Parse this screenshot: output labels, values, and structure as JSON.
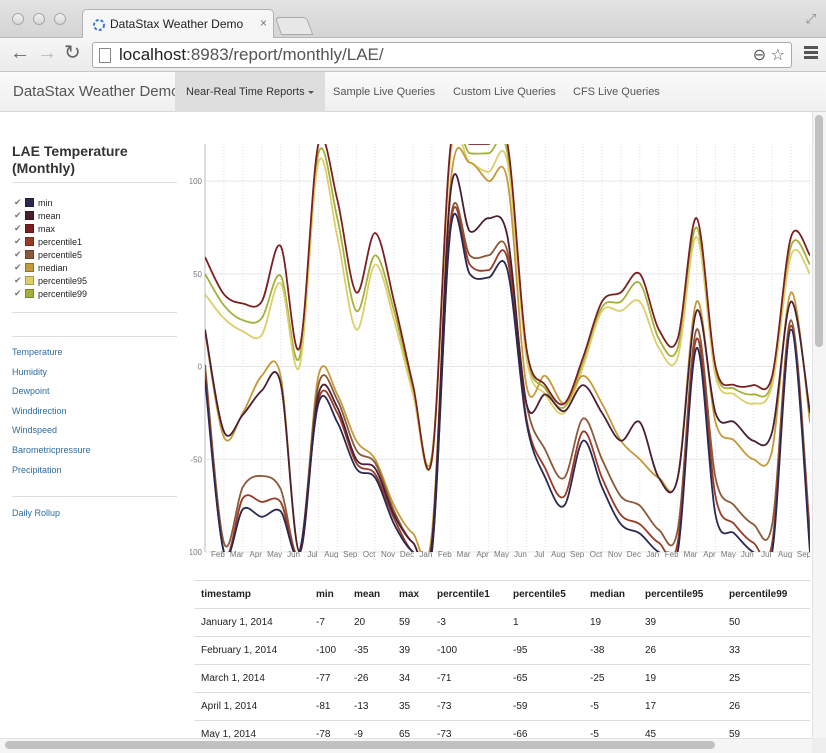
{
  "browser": {
    "tab_title": "DataStax Weather Demo",
    "tab_close": "×",
    "url_host": "localhost",
    "url_path": ":8983/report/monthly/LAE/",
    "back_icon": "←",
    "forward_icon": "→",
    "reload_icon": "↻",
    "zoom_icon": "⊖",
    "star_icon": "☆",
    "resize_icon": "⤢"
  },
  "navbar": {
    "brand": "DataStax Weather Demo",
    "items": [
      {
        "label": "Near-Real Time Reports"
      },
      {
        "label": "Sample Live Queries"
      },
      {
        "label": "Custom Live Queries"
      },
      {
        "label": "CFS Live Queries"
      }
    ]
  },
  "sidebar": {
    "title": "LAE Temperature (Monthly)",
    "check_glyph": "✔",
    "legend": [
      {
        "label": "min",
        "color": "#2b2950"
      },
      {
        "label": "mean",
        "color": "#4a1f32"
      },
      {
        "label": "max",
        "color": "#7b2020"
      },
      {
        "label": "percentile1",
        "color": "#9a3a27"
      },
      {
        "label": "percentile5",
        "color": "#8a5a3a"
      },
      {
        "label": "median",
        "color": "#c49a3a"
      },
      {
        "label": "percentile95",
        "color": "#dccf6a"
      },
      {
        "label": "percentile99",
        "color": "#a4b03c"
      }
    ],
    "links": [
      {
        "label": "Temperature"
      },
      {
        "label": "Humidity"
      },
      {
        "label": "Dewpoint"
      },
      {
        "label": "Winddirection"
      },
      {
        "label": "Windspeed"
      },
      {
        "label": "Barometricpressure"
      },
      {
        "label": "Precipitation"
      }
    ],
    "daily_rollup": "Daily Rollup"
  },
  "chart_data": {
    "type": "line",
    "ylim": [
      -100,
      120
    ],
    "yticks": [
      "100",
      "50",
      "0",
      "-50",
      "-100"
    ],
    "ytick_values": [
      100,
      50,
      0,
      -50,
      -100
    ],
    "x": [
      "Jan",
      "Feb",
      "Mar",
      "Apr",
      "May",
      "Jun",
      "Jul",
      "Aug",
      "Sep",
      "Oct",
      "Nov",
      "Dec",
      "Jan",
      "Feb",
      "Mar",
      "Apr",
      "May",
      "Jun",
      "Jul",
      "Aug",
      "Sep",
      "Oct",
      "Nov",
      "Dec",
      "Jan",
      "Feb",
      "Mar",
      "Apr",
      "May",
      "Jun",
      "Jul",
      "Aug",
      "Sep"
    ],
    "xtick_labels": [
      "Feb",
      "Mar",
      "Apr",
      "May",
      "Jun",
      "Jul",
      "Aug",
      "Sep",
      "Oct",
      "Nov",
      "Dec",
      "Jan",
      "Feb",
      "Mar",
      "Apr",
      "May",
      "Jun",
      "Jul",
      "Aug",
      "Sep",
      "Oct",
      "Nov",
      "Dec",
      "Jan",
      "Feb",
      "Mar",
      "Apr",
      "May",
      "Jun",
      "Jul",
      "Aug",
      "Sep"
    ],
    "series": [
      {
        "name": "min",
        "color": "#2b2950",
        "values": [
          -7,
          -100,
          -77,
          -81,
          -78,
          -100,
          -20,
          -30,
          -55,
          -60,
          -85,
          -100,
          -100,
          75,
          50,
          48,
          52,
          -30,
          -60,
          -75,
          -40,
          -65,
          -85,
          -90,
          -100,
          -100,
          10,
          -80,
          -90,
          -100,
          -100,
          20,
          -100
        ]
      },
      {
        "name": "mean",
        "color": "#4a1f32",
        "values": [
          20,
          -35,
          -26,
          -13,
          -9,
          -100,
          -15,
          -22,
          -50,
          -55,
          -80,
          -95,
          -95,
          95,
          73,
          80,
          70,
          -20,
          -15,
          -24,
          -10,
          -25,
          -40,
          -30,
          -60,
          -60,
          30,
          -25,
          -30,
          -40,
          -35,
          35,
          -25
        ]
      },
      {
        "name": "max",
        "color": "#7b2020",
        "values": [
          59,
          39,
          34,
          35,
          65,
          10,
          120,
          90,
          40,
          72,
          35,
          -10,
          -50,
          120,
          120,
          120,
          120,
          10,
          -10,
          -20,
          5,
          35,
          40,
          50,
          20,
          15,
          80,
          0,
          -10,
          -10,
          -5,
          70,
          60
        ]
      },
      {
        "name": "percentile1",
        "color": "#9a3a27",
        "values": [
          -3,
          -100,
          -71,
          -73,
          -73,
          -100,
          -18,
          -25,
          -52,
          -58,
          -82,
          -100,
          -100,
          78,
          55,
          52,
          58,
          -28,
          -55,
          -70,
          -35,
          -60,
          -80,
          -85,
          -95,
          -95,
          15,
          -70,
          -85,
          -95,
          -95,
          22,
          -95
        ]
      },
      {
        "name": "percentile5",
        "color": "#8a5a3a",
        "values": [
          1,
          -95,
          -65,
          -59,
          -66,
          -100,
          -10,
          -18,
          -45,
          -52,
          -78,
          -95,
          -95,
          80,
          60,
          60,
          62,
          -20,
          -45,
          -60,
          -28,
          -50,
          -70,
          -75,
          -88,
          -88,
          20,
          -60,
          -75,
          -85,
          -85,
          25,
          -90
        ]
      },
      {
        "name": "median",
        "color": "#c49a3a",
        "values": [
          19,
          -38,
          -25,
          -5,
          -5,
          -100,
          -5,
          -15,
          -40,
          -50,
          -75,
          -90,
          -90,
          100,
          110,
          100,
          100,
          -10,
          -5,
          -20,
          -5,
          -20,
          -40,
          -50,
          -60,
          -60,
          35,
          -30,
          -40,
          -50,
          -45,
          40,
          -30
        ]
      },
      {
        "name": "percentile95",
        "color": "#dccf6a",
        "values": [
          39,
          26,
          19,
          17,
          45,
          0,
          110,
          70,
          20,
          55,
          25,
          -15,
          -50,
          115,
          110,
          105,
          110,
          5,
          -15,
          -25,
          0,
          30,
          30,
          35,
          10,
          5,
          70,
          -5,
          -15,
          -20,
          -10,
          60,
          50
        ]
      },
      {
        "name": "percentile99",
        "color": "#a4b03c",
        "values": [
          50,
          33,
          25,
          26,
          49,
          5,
          115,
          80,
          30,
          60,
          30,
          -12,
          -48,
          118,
          115,
          115,
          115,
          8,
          -12,
          -22,
          2,
          32,
          35,
          45,
          15,
          10,
          75,
          -2,
          -12,
          -15,
          -8,
          65,
          55
        ]
      }
    ]
  },
  "table": {
    "headers": [
      "timestamp",
      "min",
      "mean",
      "max",
      "percentile1",
      "percentile5",
      "median",
      "percentile95",
      "percentile99"
    ],
    "rows": [
      [
        "January 1, 2014",
        "-7",
        "20",
        "59",
        "-3",
        "1",
        "19",
        "39",
        "50"
      ],
      [
        "February 1, 2014",
        "-100",
        "-35",
        "39",
        "-100",
        "-95",
        "-38",
        "26",
        "33"
      ],
      [
        "March 1, 2014",
        "-77",
        "-26",
        "34",
        "-71",
        "-65",
        "-25",
        "19",
        "25"
      ],
      [
        "April 1, 2014",
        "-81",
        "-13",
        "35",
        "-73",
        "-59",
        "-5",
        "17",
        "26"
      ],
      [
        "May 1, 2014",
        "-78",
        "-9",
        "65",
        "-73",
        "-66",
        "-5",
        "45",
        "59"
      ]
    ]
  }
}
